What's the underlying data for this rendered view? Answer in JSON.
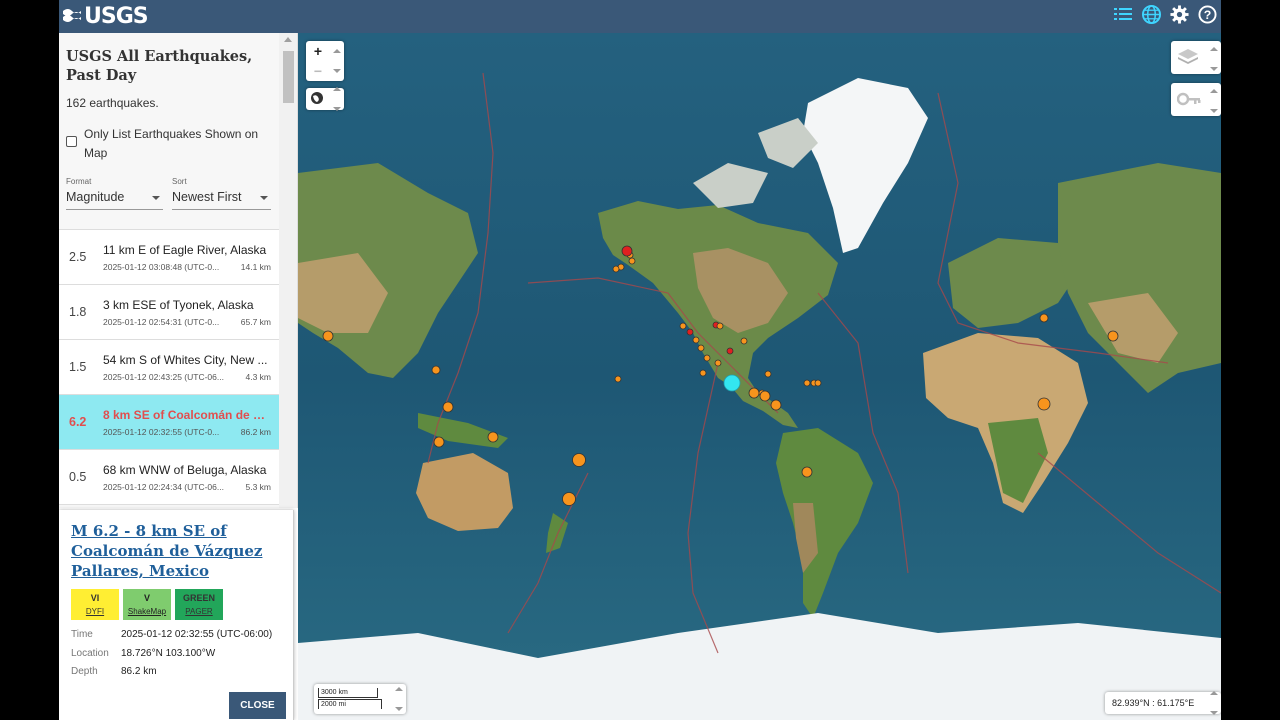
{
  "header": {
    "logo_text": "USGS",
    "icons": [
      "list-icon",
      "globe-icon",
      "gear-icon",
      "help-icon"
    ]
  },
  "list": {
    "title": "USGS All Earthquakes, Past Day",
    "count": "162 earthquakes.",
    "only_list_label": "Only List Earthquakes Shown on Map",
    "format_label": "Format",
    "format_value": "Magnitude",
    "sort_label": "Sort",
    "sort_value": "Newest First",
    "items": [
      {
        "mag": "2.5",
        "place": "11 km E of Eagle River, Alaska",
        "time": "2025-01-12 03:08:48 (UTC-0...",
        "depth": "14.1 km"
      },
      {
        "mag": "1.8",
        "place": "3 km ESE of Tyonek, Alaska",
        "time": "2025-01-12 02:54:31 (UTC-0...",
        "depth": "65.7 km"
      },
      {
        "mag": "1.5",
        "place": "54 km S of Whites City, New ...",
        "time": "2025-01-12 02:43:25 (UTC-06...",
        "depth": "4.3 km"
      },
      {
        "mag": "6.2",
        "place": "8 km SE of Coalcomán de Vá...",
        "time": "2025-01-12 02:32:55 (UTC-0...",
        "depth": "86.2 km"
      },
      {
        "mag": "0.5",
        "place": "68 km WNW of Beluga, Alaska",
        "time": "2025-01-12 02:24:34 (UTC-06...",
        "depth": "5.3 km"
      }
    ]
  },
  "details": {
    "title": "M 6.2 - 8 km SE of Coalcomán de Vázquez Pallares, Mexico",
    "dyfi_value": "VI",
    "dyfi_label": "DYFI",
    "shakemap_value": "V",
    "shakemap_label": "ShakeMap",
    "pager_value": "GREEN",
    "pager_label": "PAGER",
    "time_label": "Time",
    "time_value": "2025-01-12 02:32:55 (UTC-06:00)",
    "location_label": "Location",
    "location_value": "18.726°N 103.100°W",
    "depth_label": "Depth",
    "depth_value": "86.2 km",
    "close_label": "CLOSE"
  },
  "map": {
    "zoom_in": "+",
    "zoom_out": "−",
    "scale_km": "3000 km",
    "scale_mi": "2000 mi",
    "coords": "82.939°N : 61.175°E"
  },
  "colors": {
    "header_bg": "#3a5878",
    "selected_row": "#8ee9f1",
    "selected_text": "#e14e4e",
    "ocean": "#1f5b78",
    "quake_orange": "#f7941d",
    "quake_red": "#e02020",
    "selected_quake": "#33e6f0"
  }
}
